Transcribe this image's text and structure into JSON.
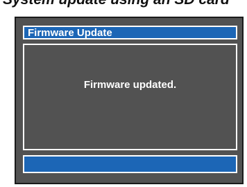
{
  "caption": {
    "text": "System update using an SD card"
  },
  "dialog": {
    "title": "Firmware Update",
    "message": "Firmware updated.",
    "status": ""
  },
  "colors": {
    "screen_background": "#525252",
    "title_bar": "#1c66b6",
    "status_bar": "#1c66b6",
    "frame_border": "#ffffff",
    "text": "#ffffff"
  }
}
